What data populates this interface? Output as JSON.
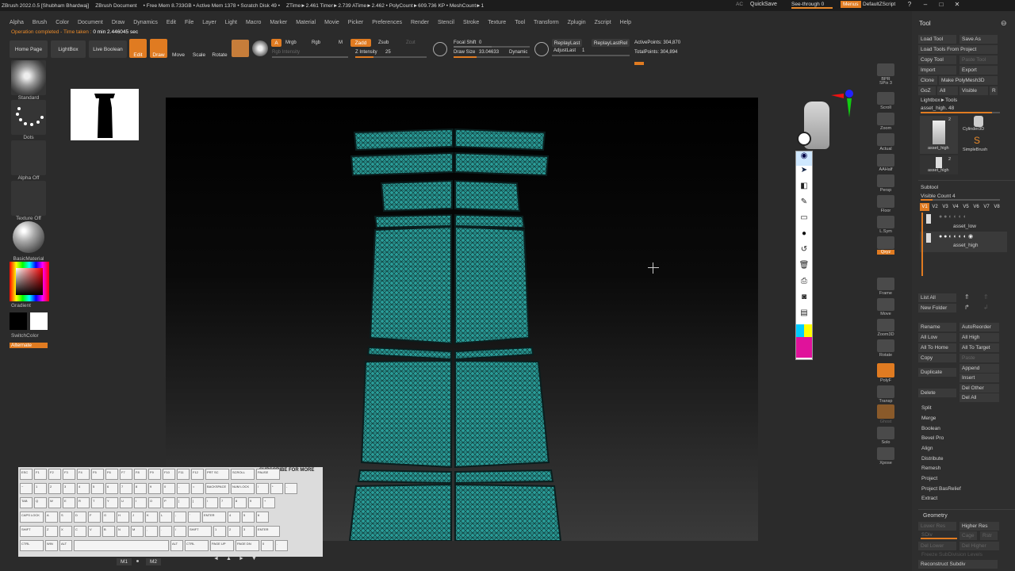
{
  "titlebar": {
    "items": [
      "ZBrush 2022.0.5 [Shubham Bhardwaj]",
      "ZBrush Document",
      "• Free Mem 8.733GB • Active Mem 1378 • Scratch Disk 49 •",
      "ZTime►2.461 Timer►2.739 ATime►2.462 • PolyCount►609.736 KP • MeshCount►1"
    ],
    "ac": "AC",
    "quicksave": "QuickSave",
    "see_through": "See-through  0",
    "menus": "Menus",
    "default_zscript": "DefaultZScript",
    "window_buttons": [
      "?",
      "–",
      "□",
      "✕"
    ]
  },
  "menubar": [
    "Alpha",
    "Brush",
    "Color",
    "Document",
    "Draw",
    "Dynamics",
    "Edit",
    "File",
    "Layer",
    "Light",
    "Macro",
    "Marker",
    "Material",
    "Movie",
    "Picker",
    "Preferences",
    "Render",
    "Stencil",
    "Stroke",
    "Texture",
    "Tool",
    "Transform",
    "Zplugin",
    "Zscript",
    "Help"
  ],
  "status": {
    "text": "Operation completed - Time taken :",
    "value": "0 min 2.446045 sec"
  },
  "toolbar": {
    "home_page": "Home Page",
    "lightbox": "LightBox",
    "live_boolean": "Live Boolean",
    "edit": "Edit",
    "draw": "Draw",
    "move": "Move",
    "scale": "Scale",
    "rotate": "Rotate",
    "a": "A",
    "mrgb": "Mrgb",
    "rgb": "Rgb",
    "m": "M",
    "zadd": "Zadd",
    "zsub": "Zsub",
    "zcut": "Zcut",
    "rgb_intensity": "Rgb Intensity",
    "z_intensity_label": "Z Intensity",
    "z_intensity_value": "25",
    "z_intensity_fill": 0.25,
    "focal_shift_label": "Focal Shift",
    "focal_shift_value": "0",
    "focal_shift_fill": 0.5,
    "draw_size_label": "Draw Size",
    "draw_size_value": "33.04633",
    "dynamic": "Dynamic",
    "replay_last": "ReplayLast",
    "replay_last_rel": "ReplayLastRel",
    "adjust_last_label": "AdjustLast",
    "adjust_last_value": "1",
    "active_points": "ActivePoints: 304,870",
    "total_points": "TotalPoints: 304,894"
  },
  "left_shelf": {
    "standard": "Standard",
    "dots": "Dots",
    "alpha_off": "Alpha Off",
    "texture_off": "Texture Off",
    "material": "BasicMaterial",
    "gradient": "Gradient",
    "switch_color": "SwitchColor",
    "alternate": "Alternate"
  },
  "right_shelf": [
    "BPR",
    "SPix 3",
    "Scroll",
    "Zoom",
    "Actual",
    "AAHalf",
    "Persp",
    "Floor",
    "L.Sym",
    "Qxyz",
    "Frame",
    "Move",
    "Zoom3D",
    "Rotate",
    "PolyF",
    "Transp",
    "Ghost",
    "Solo",
    "Xpose"
  ],
  "keyboard": {
    "banner": "SUBSCRIBE FOR MORE",
    "row1": [
      "ESC",
      "F1",
      "F2",
      "F3",
      "F4",
      "F5",
      "F6",
      "F7",
      "F8",
      "F9",
      "F10",
      "F11",
      "F12",
      "PRT SC",
      "SCROLL",
      "PAUSE"
    ],
    "row2": [
      "~",
      "1",
      "2",
      "3",
      "4",
      "5",
      "6",
      "7",
      "8",
      "9",
      "0",
      "-",
      "=",
      "BACKSPACE",
      "NUM LOCK",
      "/",
      "*",
      "-"
    ],
    "row3": [
      "TAB",
      "Q",
      "W",
      "E",
      "R",
      "T",
      "Y",
      "U",
      "I",
      "O",
      "P",
      "[",
      "]",
      "\\",
      "7",
      "8",
      "9",
      "+"
    ],
    "row4": [
      "CAPS LOCK",
      "A",
      "S",
      "D",
      "F",
      "G",
      "H",
      "J",
      "K",
      "L",
      ";",
      "'",
      "ENTER",
      "4",
      "5",
      "6"
    ],
    "row5": [
      "SHIFT",
      "Z",
      "X",
      "C",
      "V",
      "B",
      "N",
      "M",
      ",",
      ".",
      "/",
      "SHIFT",
      "1",
      "2",
      "3",
      "ENTER"
    ],
    "row6": [
      "CTRL",
      "WIN",
      "ALT",
      "",
      "ALT",
      "CTRL",
      "PAGE UP",
      "PAGE DN",
      "0",
      "."
    ],
    "arrows": [
      "◄",
      "▲",
      "►",
      "▼"
    ],
    "m1": "M1",
    "m2": "M2"
  },
  "tool_panel": {
    "title": "Tool",
    "load_tool": "Load Tool",
    "save_as": "Save As",
    "load_from_project": "Load Tools From Project",
    "copy_tool": "Copy Tool",
    "paste_tool": "Paste Tool",
    "import": "Import",
    "export": "Export",
    "clone": "Clone",
    "make_polymesh": "Make PolyMesh3D",
    "goz": "GoZ",
    "all": "All",
    "visible": "Visible",
    "r": "R",
    "lightbox_tools": "Lightbox►Tools",
    "asset_high_48": "asset_high.  48",
    "thumbs": [
      {
        "label": "asset_high",
        "count": "2"
      },
      {
        "label": "Cylinder3D",
        "count": ""
      },
      {
        "label": "SimpleBrush",
        "count": ""
      },
      {
        "label": "asset_high",
        "count": "2"
      }
    ],
    "subtool_title": "Subtool",
    "visible_count": "Visible Count 4",
    "versions": [
      "V1",
      "V2",
      "V3",
      "V4",
      "V5",
      "V6",
      "V7",
      "V8"
    ],
    "subtools": [
      "asset_low",
      "asset_high"
    ],
    "list_all": "List All",
    "new_folder": "New Folder",
    "rename": "Rename",
    "auto_reorder": "AutoReorder",
    "all_low": "All Low",
    "all_high": "All High",
    "all_to_home": "All To Home",
    "all_to_target": "All To Target",
    "copy": "Copy",
    "paste": "Paste",
    "duplicate": "Duplicate",
    "append": "Append",
    "insert": "Insert",
    "delete": "Delete",
    "del_other": "Del Other",
    "del_all": "Del All",
    "ops": [
      "Split",
      "Merge",
      "Boolean",
      "Bevel Pro",
      "Align",
      "Distribute",
      "Remesh",
      "Project",
      "Project BasRelief",
      "Extract"
    ],
    "geometry_title": "Geometry",
    "lower_res": "Lower Res",
    "higher_res": "Higher Res",
    "sdiv": "SDiv",
    "cage": "Cage",
    "rstr": "Rstr",
    "del_lower": "Del Lower",
    "del_higher": "Del Higher",
    "freeze_subdiv": "Freeze SubDivision Levels",
    "reconstruct_subdiv": "Reconstruct Subdiv"
  },
  "colors": {
    "accent": "#e07b21",
    "mesh": "#2a9e9a",
    "panel": "#2e2e2e",
    "background": "#2b2b2b"
  }
}
